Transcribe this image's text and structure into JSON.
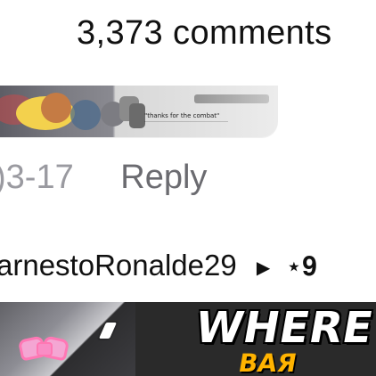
{
  "comments": {
    "count_text": "3,373 comments"
  },
  "sticker": {
    "caption": "\"thanks for the combat\""
  },
  "comment_meta": {
    "date": ")3-17",
    "reply_label": "Reply"
  },
  "next_comment": {
    "username": "arnestoRonalde29",
    "arrow_icon": "play-arrow-icon",
    "partial_badge": "⋆𝟗"
  },
  "banner": {
    "headline": "WHERE",
    "subtext": "ВАЯ"
  }
}
